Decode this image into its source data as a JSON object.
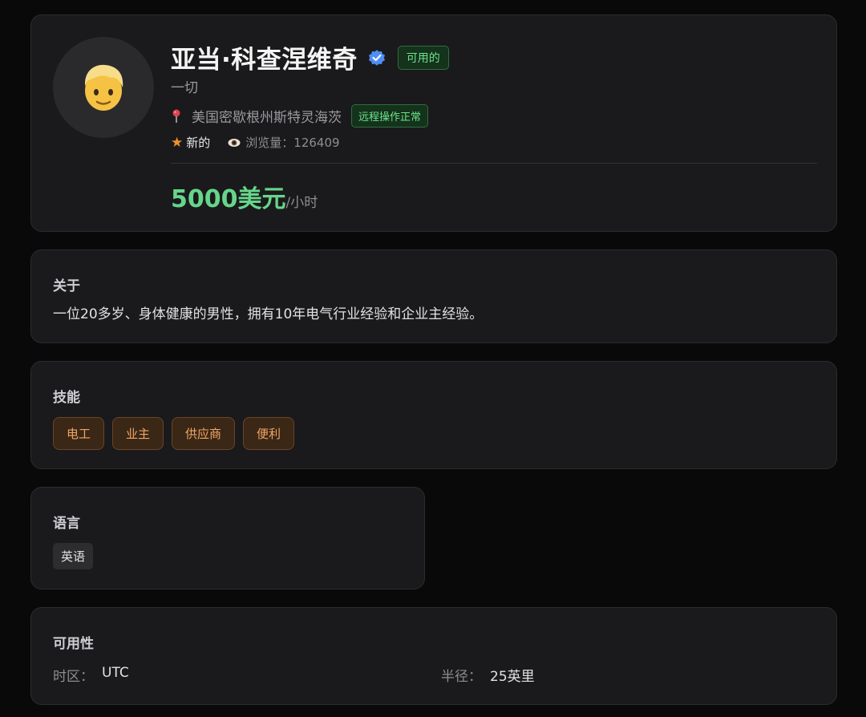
{
  "profile": {
    "avatar_emoji": "👱",
    "name": "亚当·科查涅维奇",
    "status_badge": "可用的",
    "role": "一切",
    "location": "美国密歇根州斯特灵海茨",
    "remote_badge": "远程操作正常",
    "new_label": "新的",
    "views_label": "浏览量：",
    "views_value": "126409",
    "price": "5000美元",
    "price_unit": "/小时"
  },
  "about": {
    "title": "关于",
    "text": "一位20多岁、身体健康的男性，拥有10年电气行业经验和企业主经验。"
  },
  "skills": {
    "title": "技能",
    "items": [
      "电工",
      "业主",
      "供应商",
      "便利"
    ]
  },
  "languages": {
    "title": "语言",
    "items": [
      "英语"
    ]
  },
  "availability": {
    "title": "可用性",
    "timezone_label": "时区：",
    "timezone_value": "UTC",
    "radius_label": "半径：",
    "radius_value": "25英里"
  },
  "colors": {
    "accent_green": "#66d58a",
    "skill_orange": "#f0a564",
    "verified_blue": "#4f8ef7",
    "card_bg": "#1a1a1c"
  }
}
